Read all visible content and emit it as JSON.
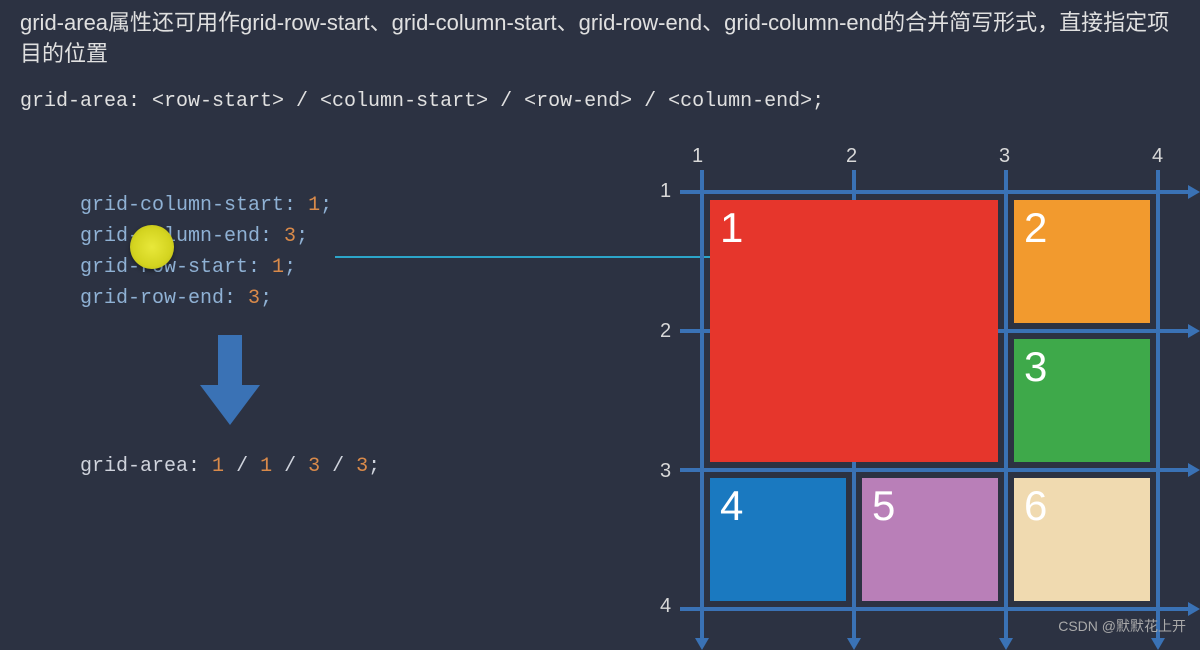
{
  "intro": "grid-area属性还可用作grid-row-start、grid-column-start、grid-row-end、grid-column-end的合并简写形式，直接指定项目的位置",
  "syntax": "grid-area: <row-start> / <column-start> / <row-end> / <column-end>;",
  "code": {
    "l1_prop": "grid-column-start",
    "l1_val": "1",
    "l2_prop": "grid-column-end",
    "l2_val": "3",
    "l3_prop": "grid-row-start",
    "l3_val": "1",
    "l4_prop": "grid-row-end",
    "l4_val": "3"
  },
  "shorthand": {
    "prop": "grid-area",
    "v1": "1",
    "v2": "1",
    "v3": "3",
    "v4": "3"
  },
  "grid": {
    "col_labels": [
      "1",
      "2",
      "3",
      "4"
    ],
    "row_labels": [
      "1",
      "2",
      "3",
      "4"
    ],
    "cells": [
      {
        "label": "1",
        "color": "#e6362c"
      },
      {
        "label": "2",
        "color": "#f29a2e"
      },
      {
        "label": "3",
        "color": "#3ea94a"
      },
      {
        "label": "4",
        "color": "#1a79c0"
      },
      {
        "label": "5",
        "color": "#b97fb8"
      },
      {
        "label": "6",
        "color": "#f0dab0"
      }
    ]
  },
  "watermark": "CSDN @默默花上开"
}
